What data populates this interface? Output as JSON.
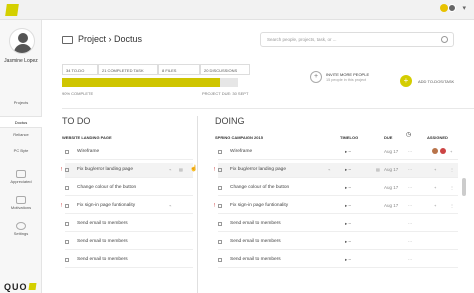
{
  "sidebar": {
    "user_name": "Jasmine Lopez",
    "items": [
      {
        "label": "Projects",
        "icon": "projects-icon"
      },
      {
        "label": "Doctus",
        "icon": ""
      },
      {
        "label": "Reliance",
        "icon": ""
      },
      {
        "label": "PC Byte",
        "icon": ""
      },
      {
        "label": "Appreciated",
        "icon": "heart-icon"
      },
      {
        "label": "Motivations",
        "icon": "motivation-icon"
      },
      {
        "label": "Settings",
        "icon": "gear-icon"
      }
    ],
    "brand": "QUO"
  },
  "header": {
    "breadcrumb": "Project › Doctus",
    "search_placeholder": "Search people, projects, task, or ..."
  },
  "stats": [
    "34 TO-DO",
    "21 COMPLETED TASK",
    "8 FILES",
    "20 DISCUSSIONS"
  ],
  "progress": {
    "percent": 90,
    "label": "90% COMPLETE",
    "due": "PROJECT DUE: 30 SEPT"
  },
  "invite": {
    "title": "INVITE MORE PEOPLE",
    "subtitle": "15 people in this project"
  },
  "add_todo_label": "ADD TO-DOS/TASK",
  "todo": {
    "title": "TO DO",
    "section": "WEBSITE LANDING PAGE",
    "rows": [
      {
        "text": "Wireframe",
        "flag": false
      },
      {
        "text": "Fix bug/error landing page",
        "flag": true
      },
      {
        "text": "Change colour of the button",
        "flag": false
      },
      {
        "text": "Fix sign-in page funtionality",
        "flag": true
      },
      {
        "text": "Send email to members",
        "flag": false
      },
      {
        "text": "Send email to members",
        "flag": false
      },
      {
        "text": "Send email to members",
        "flag": false
      }
    ]
  },
  "doing": {
    "title": "DOING",
    "section": "SPRING CAMPAIGN 2015",
    "col_timelog": "TIMELOG",
    "col_due": "DUE",
    "col_assigned": "ASSIGNED",
    "rows": [
      {
        "text": "Wireframe",
        "due": "Aug 17",
        "flag": false
      },
      {
        "text": "Fix bug/error landing page",
        "due": "Aug 17",
        "flag": true
      },
      {
        "text": "Change colour of the button",
        "due": "Aug 17",
        "flag": false
      },
      {
        "text": "Fix sign-in page funtionality",
        "due": "Aug 17",
        "flag": true
      },
      {
        "text": "Send email to members",
        "due": "",
        "flag": false
      },
      {
        "text": "Send email to members",
        "due": "",
        "flag": false
      },
      {
        "text": "Send email to members",
        "due": "",
        "flag": false
      }
    ]
  },
  "colors": {
    "accent": "#d4cd00",
    "flag": "#cc3333"
  }
}
